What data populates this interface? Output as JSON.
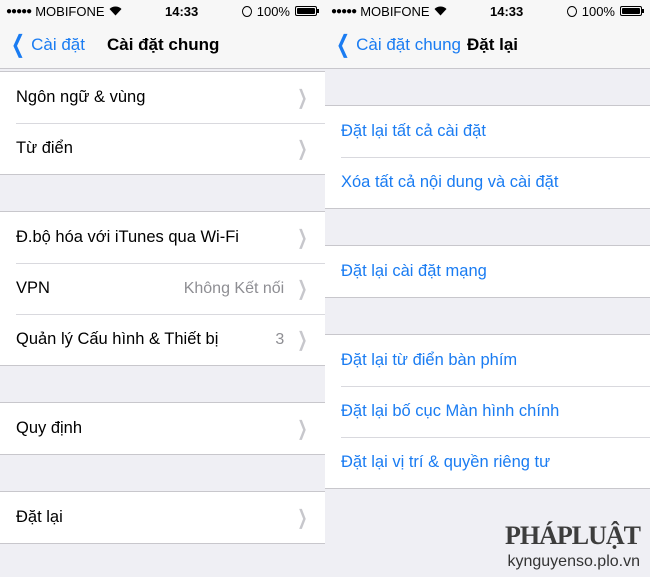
{
  "left": {
    "status": {
      "carrier": "MOBIFONE",
      "time": "14:33",
      "battery": "100%"
    },
    "nav": {
      "back_label": "Cài đặt",
      "title": "Cài đặt chung"
    },
    "groups": [
      [
        {
          "label": "Ngôn ngữ & vùng"
        },
        {
          "label": "Từ điển"
        }
      ],
      [
        {
          "label": "Đ.bộ hóa với iTunes qua Wi-Fi"
        },
        {
          "label": "VPN",
          "value": "Không Kết nối"
        },
        {
          "label": "Quản lý Cấu hình & Thiết bị",
          "value": "3"
        }
      ],
      [
        {
          "label": "Quy định"
        }
      ],
      [
        {
          "label": "Đặt lại"
        }
      ]
    ]
  },
  "right": {
    "status": {
      "carrier": "MOBIFONE",
      "time": "14:33",
      "battery": "100%"
    },
    "nav": {
      "back_label": "Cài đặt chung",
      "title": "Đặt lại"
    },
    "groups": [
      [
        {
          "label": "Đặt lại tất cả cài đặt"
        },
        {
          "label": "Xóa tất cả nội dung và cài đặt"
        }
      ],
      [
        {
          "label": "Đặt lại cài đặt mạng"
        }
      ],
      [
        {
          "label": "Đặt lại từ điển bàn phím"
        },
        {
          "label": "Đặt lại bố cục Màn hình chính"
        },
        {
          "label": "Đặt lại vị trí & quyền riêng tư"
        }
      ]
    ]
  },
  "watermark": {
    "logo": "PHÁPLUẬT",
    "site": "kynguyenso.plo.vn"
  },
  "colors": {
    "link": "#1a7cf2",
    "background": "#efeff4",
    "separator": "#c8c7cc"
  }
}
